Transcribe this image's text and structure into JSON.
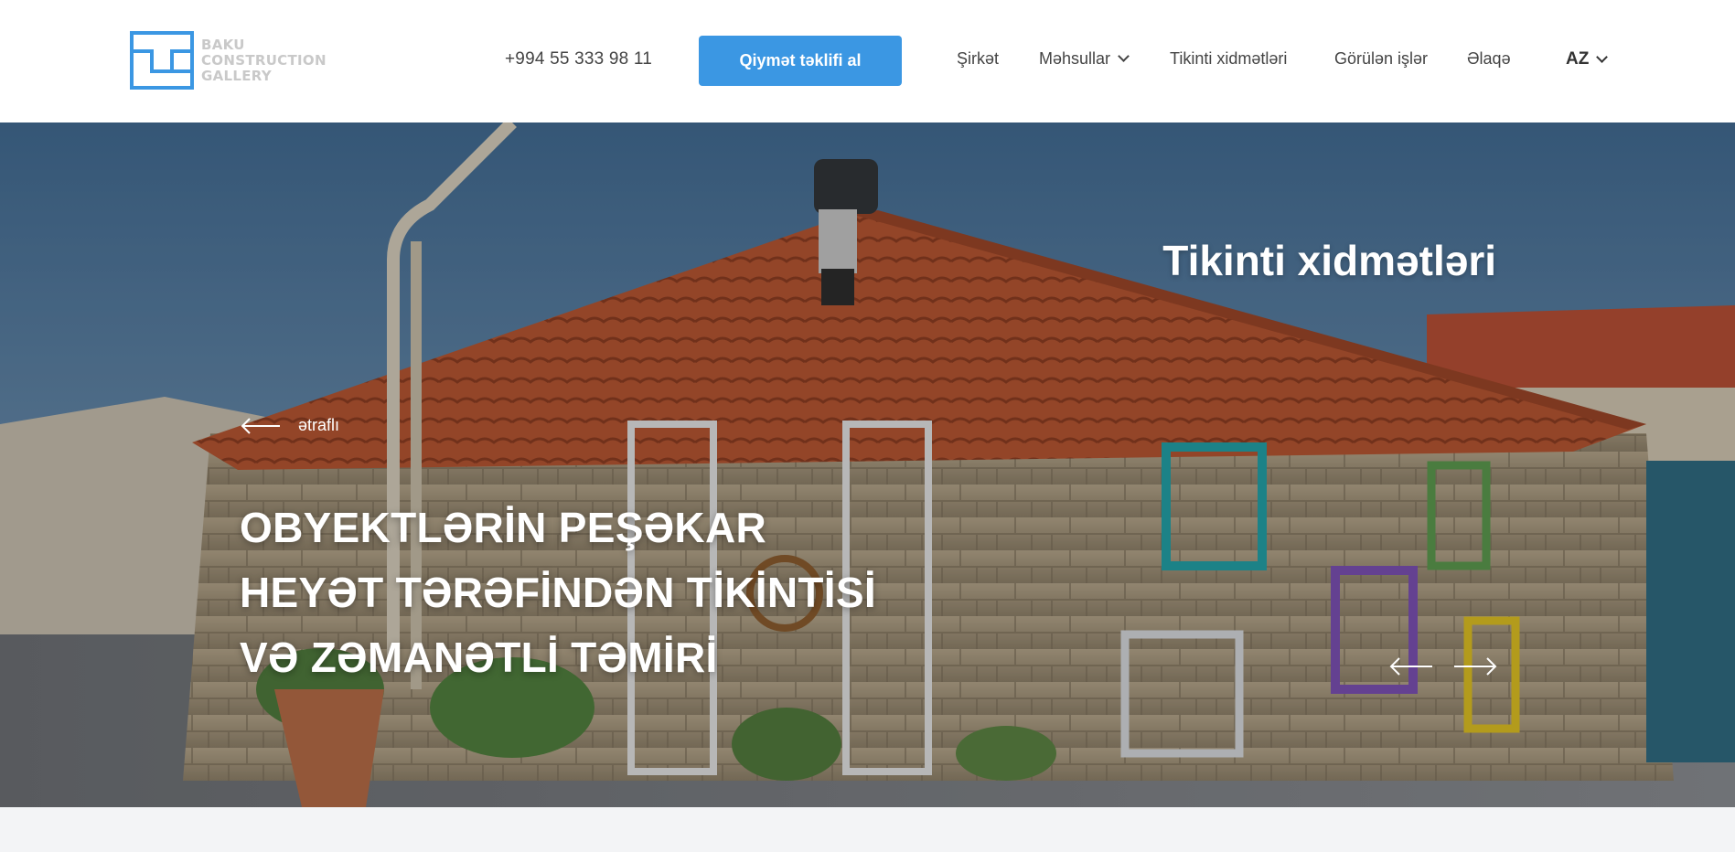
{
  "brand": {
    "logo_lines": [
      "BAKU",
      "CONSTRUCTION",
      "GALLERY"
    ],
    "logo_color": "#3b97e3"
  },
  "header": {
    "phone": "+994 55 333 98 11",
    "quote_button_label": "Qiymət təklifi al",
    "accent_color": "#3b97e3",
    "nav": [
      {
        "label": "Şirkət",
        "has_dropdown": false
      },
      {
        "label": "Məhsullar",
        "has_dropdown": true
      },
      {
        "label": "Tikinti xidmətləri",
        "has_dropdown": false
      },
      {
        "label": "Görülən işlər",
        "has_dropdown": false
      },
      {
        "label": "Əlaqə",
        "has_dropdown": false
      }
    ],
    "language": "AZ"
  },
  "hero": {
    "tag": "Tikinti xidmətləri",
    "more_link_label": "ətraflı",
    "title": "OBYEKTLƏRİN PEŞƏKAR HEYƏT TƏRƏFİNDƏN TİKİNTİSİ VƏ ZƏMANƏTLİ TƏMİRİ",
    "prev_icon": "arrow-left-icon",
    "next_icon": "arrow-right-icon"
  }
}
